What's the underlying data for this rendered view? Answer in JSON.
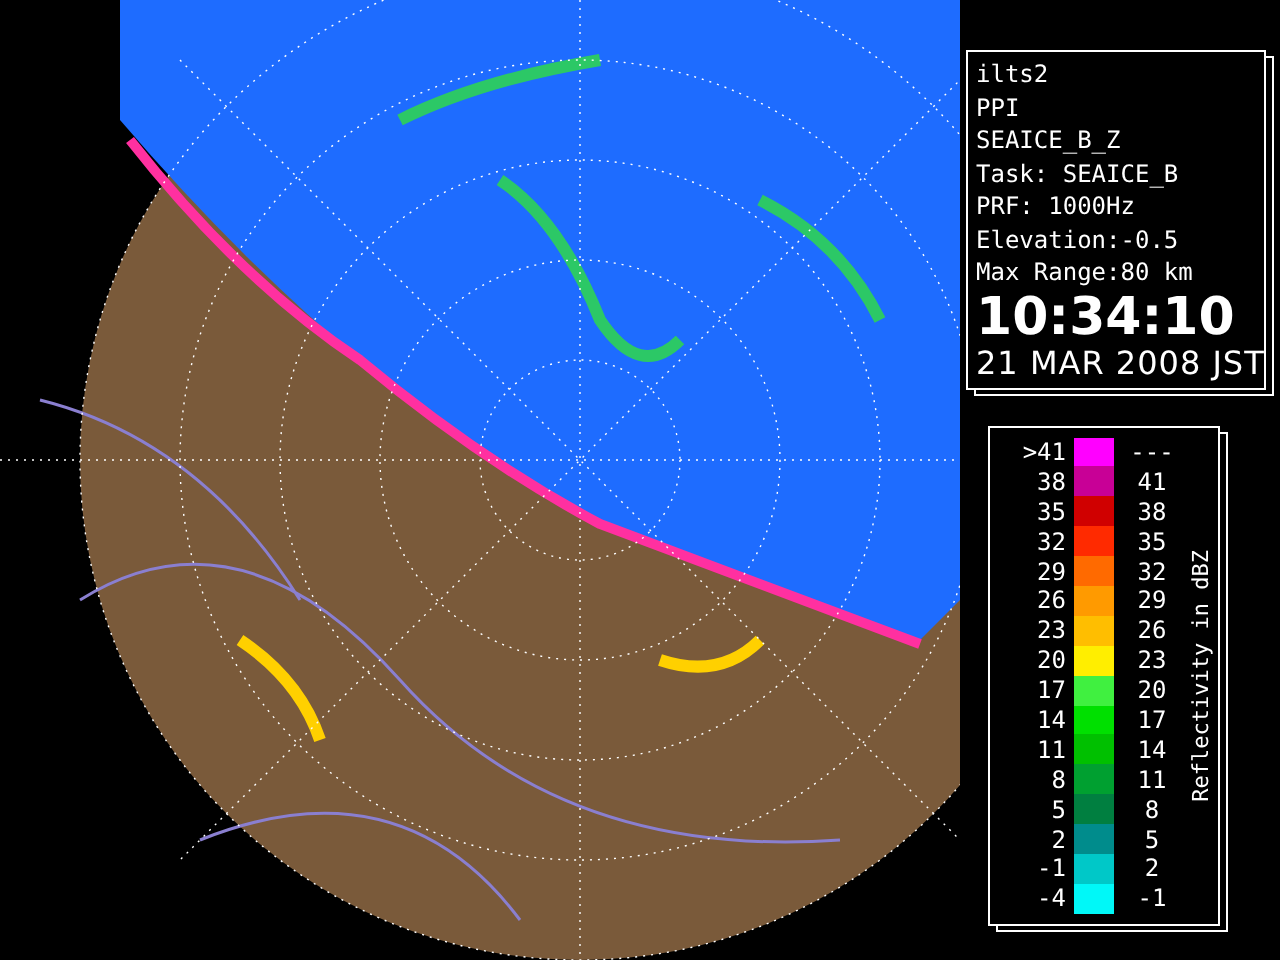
{
  "info": {
    "lines": [
      "ilts2",
      "PPI",
      "SEAICE_B_Z",
      "Task: SEAICE_B",
      "PRF: 1000Hz",
      "Elevation:-0.5",
      "Max Range:80 km"
    ],
    "time": "10:34:10",
    "date": "21 MAR 2008 JST"
  },
  "legend": {
    "title": "Reflectivity in dBZ",
    "rows": [
      {
        "low": ">41",
        "high": "---",
        "color": "#ff00ff"
      },
      {
        "low": "38",
        "high": "41",
        "color": "#c80096"
      },
      {
        "low": "35",
        "high": "38",
        "color": "#d00000"
      },
      {
        "low": "32",
        "high": "35",
        "color": "#ff2a00"
      },
      {
        "low": "29",
        "high": "32",
        "color": "#ff6a00"
      },
      {
        "low": "26",
        "high": "29",
        "color": "#ff9a00"
      },
      {
        "low": "23",
        "high": "26",
        "color": "#ffbe00"
      },
      {
        "low": "20",
        "high": "23",
        "color": "#ffee00"
      },
      {
        "low": "17",
        "high": "20",
        "color": "#40f040"
      },
      {
        "low": "14",
        "high": "17",
        "color": "#00e000"
      },
      {
        "low": "11",
        "high": "14",
        "color": "#00c000"
      },
      {
        "low": "8",
        "high": "11",
        "color": "#00a030"
      },
      {
        "low": "5",
        "high": "8",
        "color": "#007f40"
      },
      {
        "low": "2",
        "high": "5",
        "color": "#008c8c"
      },
      {
        "low": "-1",
        "high": "2",
        "color": "#00c8c8"
      },
      {
        "low": "-4",
        "high": "-1",
        "color": "#00f8f8"
      }
    ]
  }
}
